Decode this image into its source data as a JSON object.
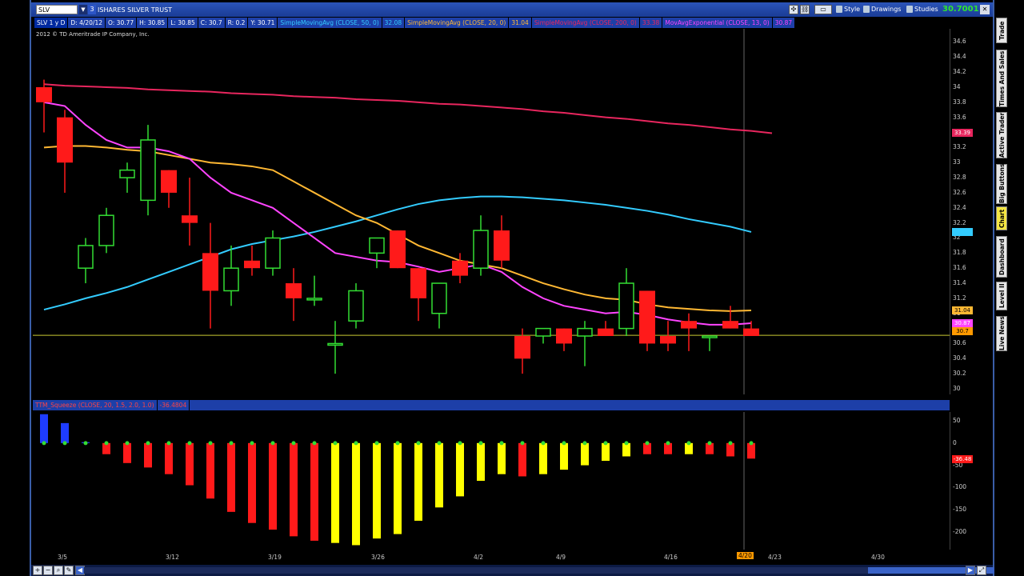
{
  "toolbar": {
    "symbol": "SLV",
    "symbol_count": "3",
    "description": "ISHARES SILVER TRUST",
    "style_label": "Style",
    "drawings_label": "Drawings",
    "studies_label": "Studies",
    "last_price": "30.7001"
  },
  "infobar": {
    "timeframe": "SLV 1 y D",
    "date": "D: 4/20/12",
    "open": "O: 30.77",
    "high": "H: 30.85",
    "low": "L: 30.85",
    "close": "C: 30.7",
    "range": "R: 0.2",
    "ycoord": "Y: 30.71",
    "studies": [
      {
        "label": "SimpleMovingAvg (CLOSE, 50, 0)",
        "value": "32.08",
        "color": "#33ccff"
      },
      {
        "label": "SimpleMovingAvg (CLOSE, 20, 0)",
        "value": "31.04",
        "color": "#ffb833"
      },
      {
        "label": "SimpleMovingAvg (CLOSE, 200, 0)",
        "value": "33.38",
        "color": "#e8265e"
      },
      {
        "label": "MovAvgExponential (CLOSE, 13, 0)",
        "value": "30.87",
        "color": "#ff44ff"
      }
    ]
  },
  "copyright": "2012 © TD Ameritrade IP Company, Inc.",
  "squeeze": {
    "label": "TTM_Squeeze (CLOSE, 20, 1.5, 2.0, 1.0)",
    "value": "-36.4804",
    "current_tag": "-36.48"
  },
  "price_axis_labels": [
    "34.6",
    "34.4",
    "34.2",
    "34",
    "33.8",
    "33.6",
    "33.4",
    "33.2",
    "33",
    "32.8",
    "32.6",
    "32.4",
    "32.2",
    "32",
    "31.8",
    "31.6",
    "31.4",
    "31.2",
    "31",
    "30.8",
    "30.6",
    "30.4",
    "30.2",
    "30"
  ],
  "price_tags": {
    "sma200": "33.39",
    "sma50": "32.08",
    "sma20": "31.04",
    "ema13": "30.87",
    "last": "30.7"
  },
  "osc_axis_labels": [
    "50",
    "0",
    "-50",
    "-100",
    "-150",
    "-200"
  ],
  "date_labels": [
    "3/5",
    "3/12",
    "3/19",
    "3/26",
    "4/2",
    "4/9",
    "4/16",
    "4/23",
    "4/30"
  ],
  "cursor_date": "4/20",
  "side_tabs": [
    "Trade",
    "Times And Sales",
    "Active Trader",
    "Big Buttons",
    "Chart",
    "Dashboard",
    "Level II",
    "Live News"
  ],
  "active_tab": "Chart",
  "chart_data": {
    "type": "candlestick",
    "price_range": [
      30,
      34.7
    ],
    "candles": [
      {
        "o": 34.0,
        "h": 34.1,
        "l": 33.4,
        "c": 33.8
      },
      {
        "o": 33.6,
        "h": 33.7,
        "l": 32.6,
        "c": 33.0
      },
      {
        "o": 31.6,
        "h": 32.0,
        "l": 31.4,
        "c": 31.9
      },
      {
        "o": 31.9,
        "h": 32.4,
        "l": 31.8,
        "c": 32.3
      },
      {
        "o": 32.8,
        "h": 33.0,
        "l": 32.6,
        "c": 32.9
      },
      {
        "o": 32.5,
        "h": 33.5,
        "l": 32.3,
        "c": 33.3
      },
      {
        "o": 32.9,
        "h": 32.9,
        "l": 32.4,
        "c": 32.6
      },
      {
        "o": 32.3,
        "h": 32.8,
        "l": 31.9,
        "c": 32.2
      },
      {
        "o": 31.8,
        "h": 32.2,
        "l": 30.8,
        "c": 31.3
      },
      {
        "o": 31.3,
        "h": 31.9,
        "l": 31.1,
        "c": 31.6
      },
      {
        "o": 31.7,
        "h": 31.9,
        "l": 31.5,
        "c": 31.6
      },
      {
        "o": 31.6,
        "h": 32.1,
        "l": 31.5,
        "c": 32.0
      },
      {
        "o": 31.4,
        "h": 31.6,
        "l": 30.9,
        "c": 31.2
      },
      {
        "o": 31.2,
        "h": 31.5,
        "l": 31.1,
        "c": 31.2
      },
      {
        "o": 30.6,
        "h": 30.9,
        "l": 30.2,
        "c": 30.6
      },
      {
        "o": 30.9,
        "h": 31.4,
        "l": 30.8,
        "c": 31.3
      },
      {
        "o": 31.8,
        "h": 32.0,
        "l": 31.6,
        "c": 32.0
      },
      {
        "o": 32.1,
        "h": 32.1,
        "l": 31.6,
        "c": 31.6
      },
      {
        "o": 31.6,
        "h": 31.6,
        "l": 30.9,
        "c": 31.2
      },
      {
        "o": 31.0,
        "h": 31.4,
        "l": 30.8,
        "c": 31.4
      },
      {
        "o": 31.7,
        "h": 31.8,
        "l": 31.4,
        "c": 31.5
      },
      {
        "o": 31.6,
        "h": 32.3,
        "l": 31.5,
        "c": 32.1
      },
      {
        "o": 32.1,
        "h": 32.3,
        "l": 31.6,
        "c": 31.7
      },
      {
        "o": 30.7,
        "h": 30.8,
        "l": 30.2,
        "c": 30.4
      },
      {
        "o": 30.7,
        "h": 30.8,
        "l": 30.6,
        "c": 30.8
      },
      {
        "o": 30.8,
        "h": 30.8,
        "l": 30.5,
        "c": 30.6
      },
      {
        "o": 30.7,
        "h": 30.9,
        "l": 30.3,
        "c": 30.8
      },
      {
        "o": 30.8,
        "h": 30.9,
        "l": 30.7,
        "c": 30.7
      },
      {
        "o": 30.8,
        "h": 31.6,
        "l": 30.7,
        "c": 31.4
      },
      {
        "o": 31.3,
        "h": 31.3,
        "l": 30.5,
        "c": 30.6
      },
      {
        "o": 30.7,
        "h": 30.9,
        "l": 30.5,
        "c": 30.6
      },
      {
        "o": 30.9,
        "h": 31.0,
        "l": 30.5,
        "c": 30.8
      },
      {
        "o": 30.7,
        "h": 30.7,
        "l": 30.5,
        "c": 30.7
      },
      {
        "o": 30.9,
        "h": 31.1,
        "l": 30.8,
        "c": 30.8
      },
      {
        "o": 30.8,
        "h": 30.9,
        "l": 30.7,
        "c": 30.7
      }
    ],
    "sma200": [
      34.02,
      34.01,
      34.0,
      33.99,
      33.97,
      33.96,
      33.95,
      33.94,
      33.92,
      33.91,
      33.9,
      33.88,
      33.87,
      33.86,
      33.84,
      33.83,
      33.82,
      33.8,
      33.78,
      33.77,
      33.75,
      33.73,
      33.71,
      33.68,
      33.66,
      33.63,
      33.6,
      33.58,
      33.55,
      33.52,
      33.5,
      33.47,
      33.44,
      33.42,
      33.39
    ],
    "sma50": [
      31.05,
      31.12,
      31.2,
      31.27,
      31.35,
      31.45,
      31.55,
      31.65,
      31.75,
      31.85,
      31.92,
      31.97,
      32.02,
      32.08,
      32.15,
      32.22,
      32.3,
      32.38,
      32.45,
      32.5,
      32.53,
      32.55,
      32.55,
      32.54,
      32.52,
      32.5,
      32.47,
      32.44,
      32.4,
      32.36,
      32.31,
      32.25,
      32.2,
      32.15,
      32.08
    ],
    "sma20": [
      33.2,
      33.22,
      33.22,
      33.2,
      33.17,
      33.15,
      33.1,
      33.05,
      33.0,
      32.98,
      32.95,
      32.9,
      32.75,
      32.6,
      32.45,
      32.3,
      32.2,
      32.05,
      31.9,
      31.8,
      31.7,
      31.65,
      31.6,
      31.5,
      31.4,
      31.32,
      31.25,
      31.2,
      31.18,
      31.12,
      31.08,
      31.06,
      31.04,
      31.03,
      31.04
    ],
    "ema13": [
      33.8,
      33.75,
      33.5,
      33.3,
      33.2,
      33.2,
      33.15,
      33.05,
      32.8,
      32.6,
      32.5,
      32.4,
      32.2,
      32.0,
      31.8,
      31.75,
      31.7,
      31.68,
      31.62,
      31.55,
      31.6,
      31.65,
      31.55,
      31.35,
      31.2,
      31.1,
      31.05,
      31.0,
      31.02,
      30.98,
      30.92,
      30.88,
      30.85,
      30.85,
      30.87
    ],
    "squeeze_range": [
      -240,
      70
    ],
    "squeeze_hist": [
      65,
      45,
      2,
      -25,
      -45,
      -55,
      -70,
      -95,
      -125,
      -155,
      -180,
      -195,
      -210,
      -220,
      -225,
      -230,
      -215,
      -205,
      -175,
      -145,
      -120,
      -85,
      -70,
      -75,
      -70,
      -60,
      -50,
      -40,
      -30,
      -25,
      -25,
      -25,
      -25,
      -30,
      -35
    ],
    "squeeze_colors": [
      "blue",
      "blue",
      "blue",
      "red",
      "red",
      "red",
      "red",
      "red",
      "red",
      "red",
      "red",
      "red",
      "red",
      "red",
      "yellow",
      "yellow",
      "yellow",
      "yellow",
      "yellow",
      "yellow",
      "yellow",
      "yellow",
      "yellow",
      "red",
      "yellow",
      "yellow",
      "yellow",
      "yellow",
      "yellow",
      "red",
      "red",
      "yellow",
      "red",
      "red",
      "red"
    ]
  }
}
